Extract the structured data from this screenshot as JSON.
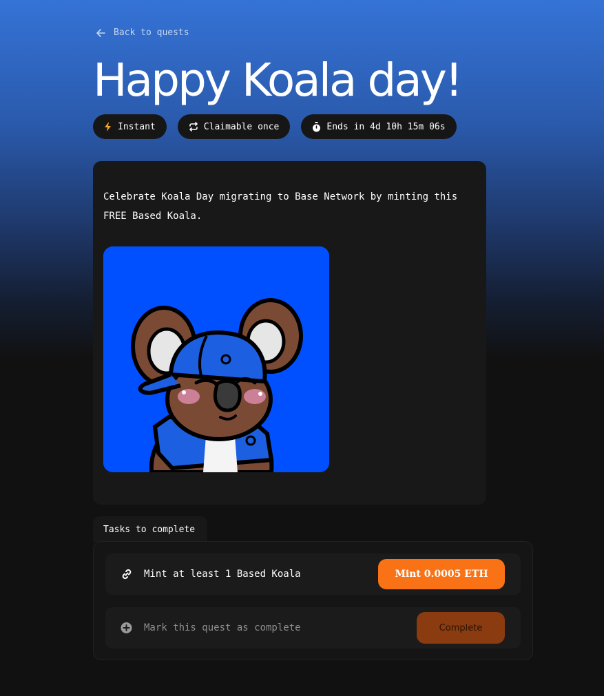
{
  "nav": {
    "back_label": "Back to quests"
  },
  "quest": {
    "title": "Happy Koala day!",
    "badges": [
      {
        "icon": "lightning-icon",
        "label": "Instant"
      },
      {
        "icon": "repeat-icon",
        "label": "Claimable once"
      },
      {
        "icon": "stopwatch-icon",
        "label": "Ends in 4d 10h 15m 06s"
      }
    ],
    "description": "Celebrate Koala Day migrating to Base Network by minting this FREE Based Koala.",
    "image_icon": "koala-nft-image"
  },
  "tasks": {
    "tab_label": "Tasks to complete",
    "items": [
      {
        "icon": "link-icon",
        "label": "Mint at least 1 Based Koala",
        "button": "Mint 0.0005 ETH"
      },
      {
        "icon": "plus-circle-icon",
        "label": "Mark this quest as complete",
        "button": "Complete"
      }
    ]
  },
  "colors": {
    "accent": "#f97316",
    "accent_dim": "#8a3b0f",
    "badge_icon": "#f5a623",
    "background_top": "#3573d6",
    "background_bottom": "#111111",
    "nft_background": "#0050ff"
  }
}
